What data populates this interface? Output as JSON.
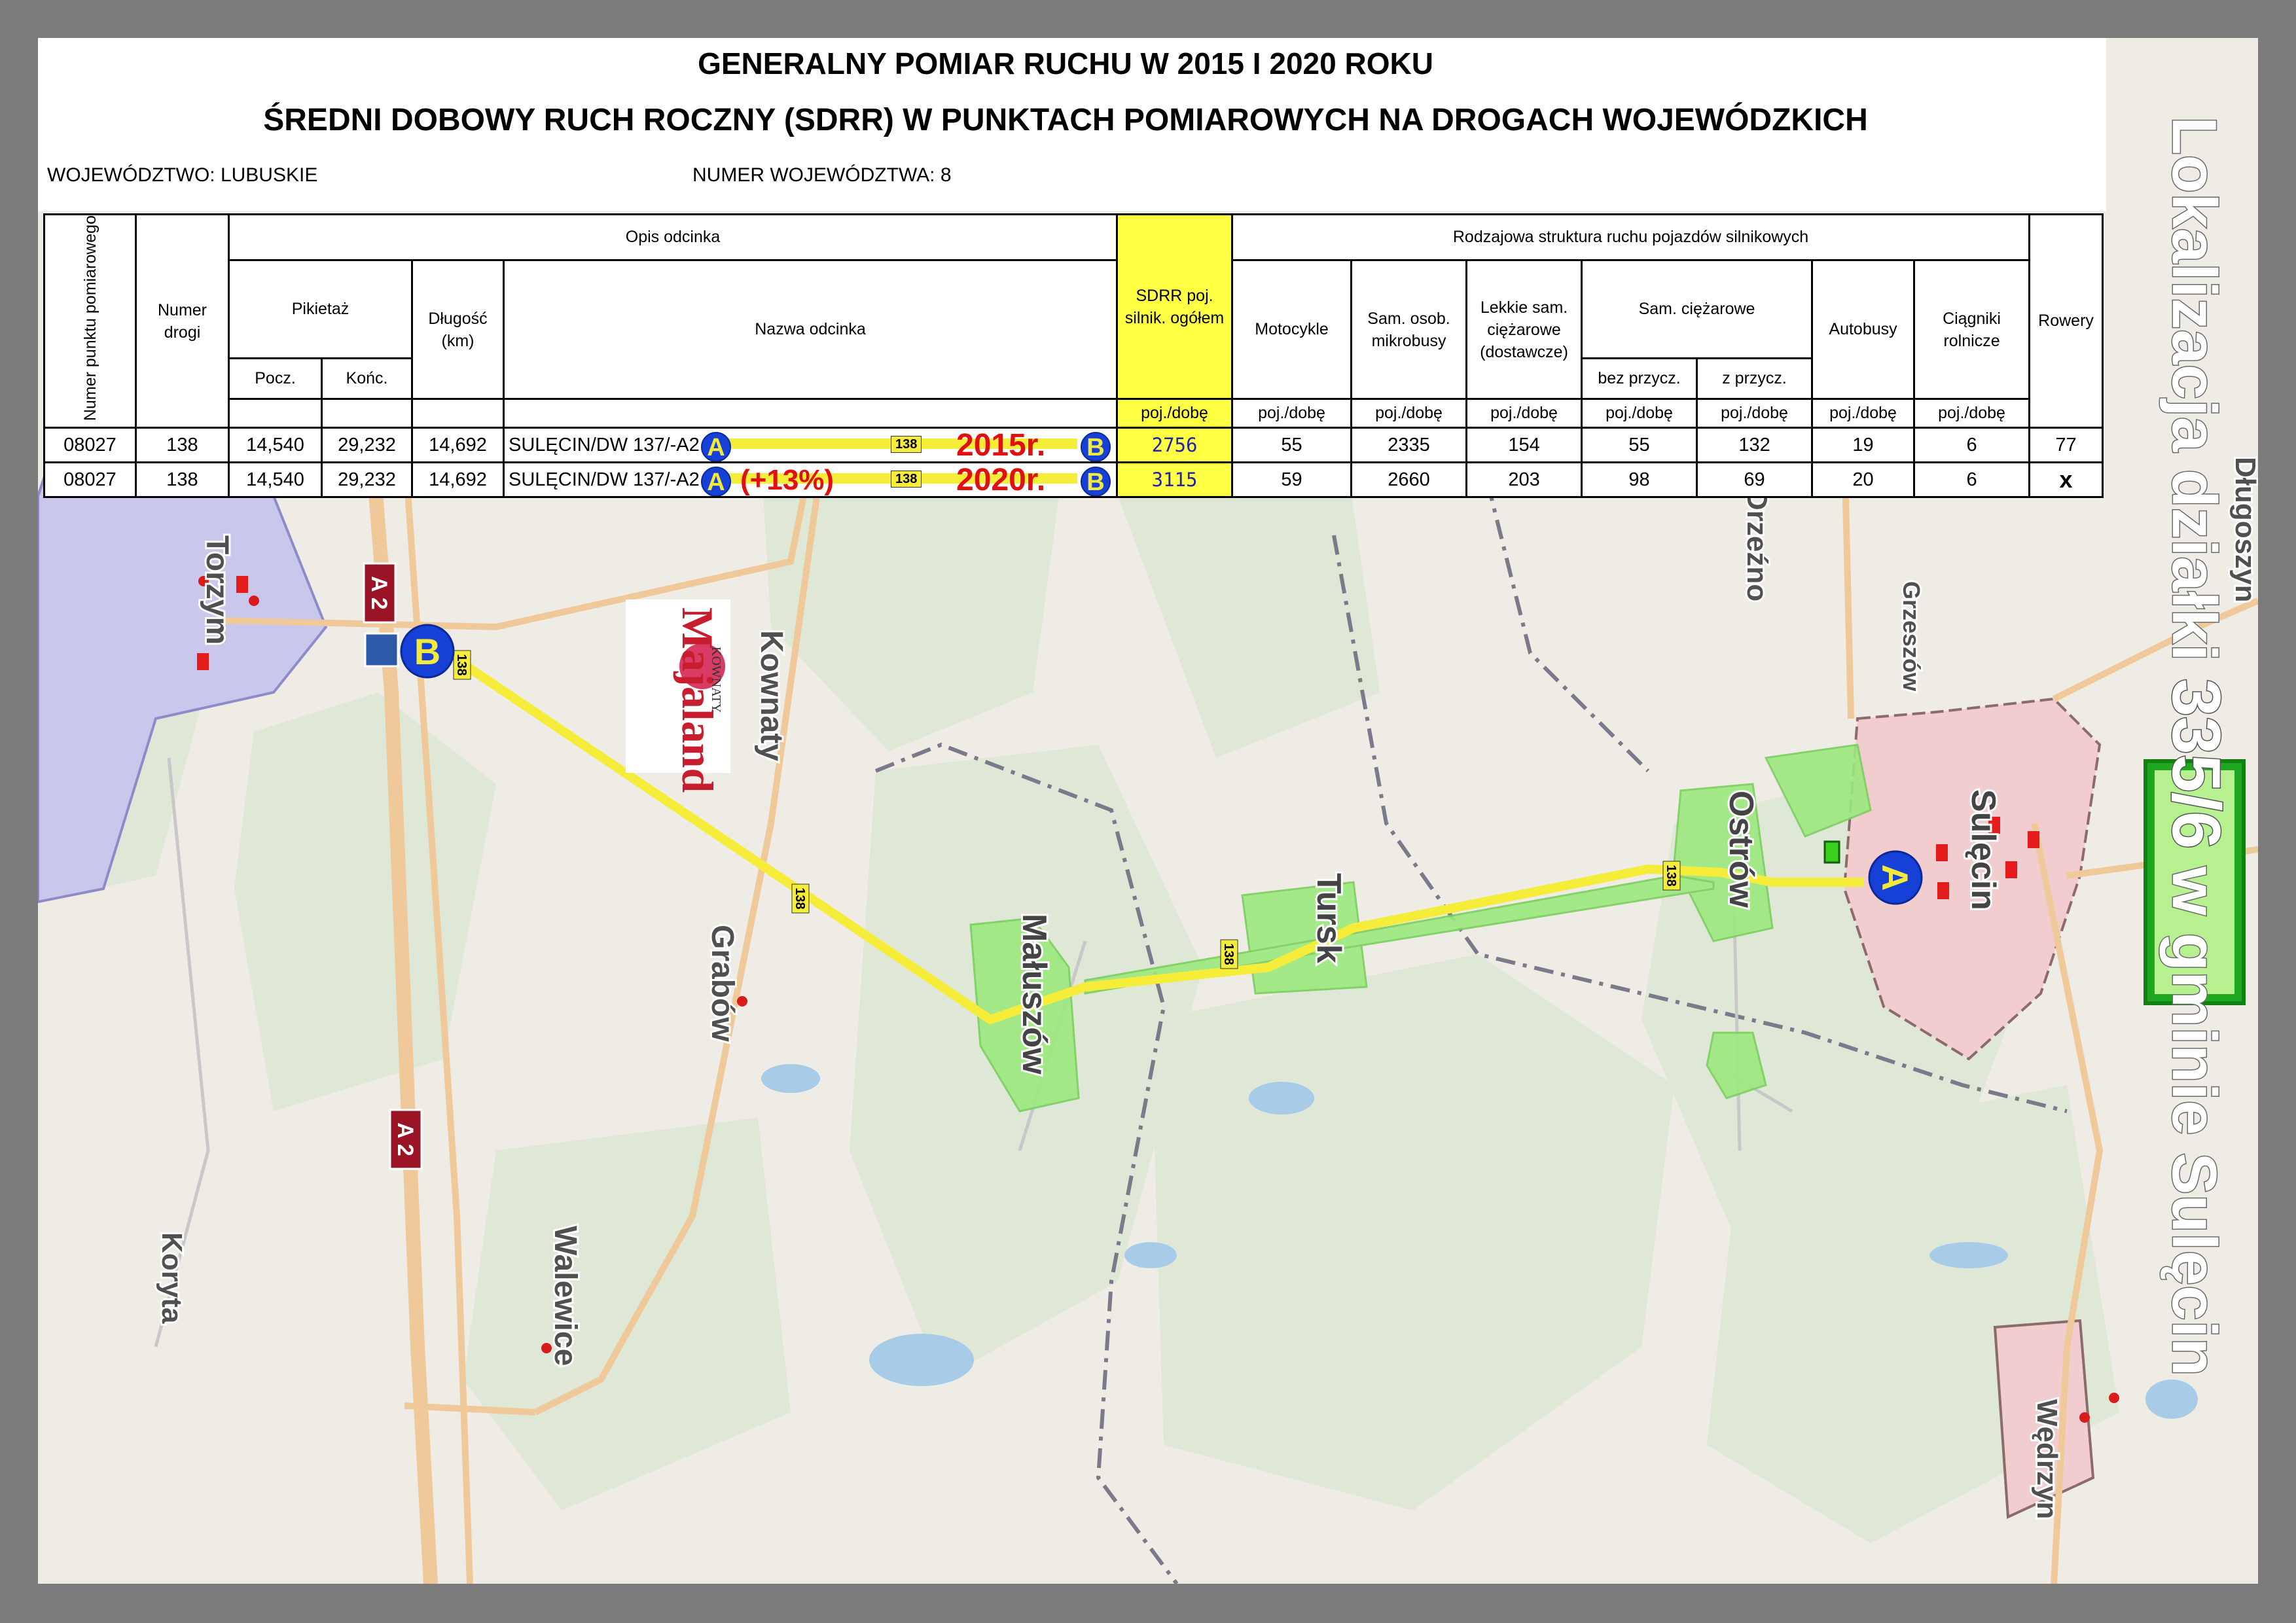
{
  "header": {
    "title_line1": "GENERALNY POMIAR RUCHU W 2015 I 2020 ROKU",
    "title_line2": "ŚREDNI DOBOWY RUCH ROCZNY (SDRR) W PUNKTACH POMIAROWYCH NA DROGACH WOJEWÓDZKICH",
    "wojewodztwo": "WOJEWÓDZTWO: LUBUSKIE",
    "numer_wojewodztwa": "NUMER WOJEWÓDZTWA: 8"
  },
  "table": {
    "h_numer_punktu": "Numer punktu pomiarowego",
    "h_numer_drogi": "Numer drogi",
    "h_opis": "Opis  odcinka",
    "h_pikietaz": "Pikietaż",
    "h_pocz": "Pocz.",
    "h_konc": "Końc.",
    "h_dlugosc": "Długość (km)",
    "h_nazwa": "Nazwa odcinka",
    "h_sdrr": "SDRR poj. silnik. ogółem",
    "h_rodzajowa": "Rodzajowa struktura ruchu pojazdów silnikowych",
    "h_motocykle": "Motocykle",
    "h_sam_osob": "Sam. osob. mikrobusy",
    "h_lekkie": "Lekkie sam. ciężarowe (dostawcze)",
    "h_sam_ciez": "Sam. ciężarowe",
    "h_bez": "bez przycz.",
    "h_z": "z przycz.",
    "h_autobusy": "Autobusy",
    "h_ciagniki": "Ciągniki rolnicze",
    "h_rowery": "Rowery",
    "unit": "poj./dobę",
    "rows": [
      {
        "punkt": "08027",
        "droga": "138",
        "pocz": "14,540",
        "konc": "29,232",
        "dl": "14,692",
        "nazwa": "SULĘCIN/DW 137/-A2",
        "a": "A",
        "b": "B",
        "shield": "138",
        "year": "2015r.",
        "pct": "",
        "sdrr": "2756",
        "moto": "55",
        "osob": "2335",
        "lekkie": "154",
        "bez": "55",
        "z": "132",
        "auto": "19",
        "ciag": "6",
        "rowery": "77"
      },
      {
        "punkt": "08027",
        "droga": "138",
        "pocz": "14,540",
        "konc": "29,232",
        "dl": "14,692",
        "nazwa": "SULĘCIN/DW 137/-A2",
        "a": "A",
        "b": "B",
        "shield": "138",
        "year": "2020r.",
        "pct": "(+13%)",
        "sdrr": "3115",
        "moto": "59",
        "osob": "2660",
        "lekkie": "203",
        "bez": "98",
        "z": "69",
        "auto": "20",
        "ciag": "6",
        "rowery": "x"
      }
    ]
  },
  "map": {
    "towns": [
      "Torzym",
      "Kownaty",
      "Grabów",
      "Małuszów",
      "Tursk",
      "Ostrów",
      "Sulęcin",
      "Walewice",
      "Koryta",
      "Wędrzyn",
      "Grzeszów",
      "Drzeźno",
      "Długoszyn"
    ],
    "road_shield": "138",
    "motorway": "A 2",
    "point_a": "A",
    "point_b": "B",
    "logo_text": "Majaland",
    "logo_sub": "KOWNATY",
    "colors": {
      "road": "#f6ec3a",
      "forest": "#dfe8d6",
      "town": "#c9c8ec",
      "town_red": "#f2cdd0",
      "green_area": "#9ce97f",
      "water": "#a8cbe8",
      "highway": "#efc99a",
      "sign_red": "#9a1426",
      "marker_blue": "#1741d6"
    }
  },
  "side_label": {
    "before": "Lokalizacja działki ",
    "parcel": "335/6",
    "after": " w gminie Sulęcin"
  }
}
